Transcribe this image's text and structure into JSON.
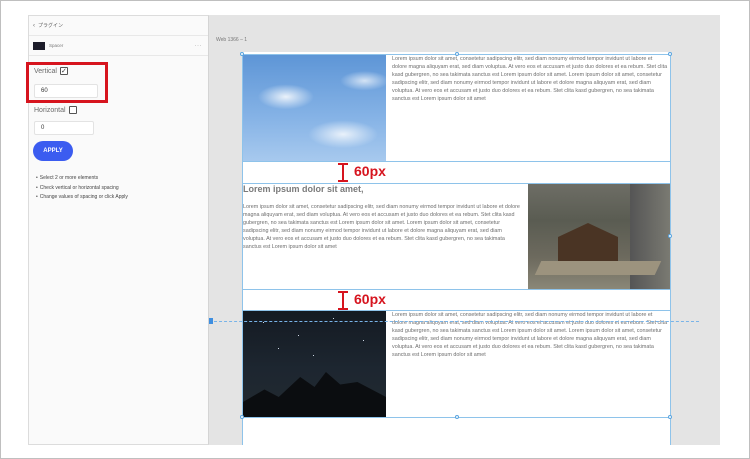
{
  "panel": {
    "back_label": "プラグイン",
    "plugin_name": "Spacer",
    "more": "···",
    "vertical_label": "Vertical",
    "vertical_checked": "✓",
    "vertical_value": "60",
    "horizontal_label": "Horizontal",
    "horizontal_value": "0",
    "apply_label": "APPLY",
    "tips": [
      "Select 2 or more elements",
      "Check vertical or horizontal spacing",
      "Change values of spacing or click Apply"
    ]
  },
  "canvas": {
    "artboard_name": "Web 1366 – 1",
    "spacing_1": "60px",
    "spacing_2": "60px",
    "heading": "Lorem ipsum dolor sit amet,",
    "body_1": "Lorem ipsum dolor sit amet, consetetur sadipscing elitr, sed diam nonumy eirmod tempor invidunt ut labore et dolore magna aliquyam erat, sed diam voluptua. At vero eos et accusam et justo duo dolores et ea rebum. Stet clita kasd gubergren, no sea takimata sanctus est Lorem ipsum dolor sit amet. Lorem ipsum dolor sit amet, consetetur sadipscing elitr, sed diam nonumy eirmod tempor invidunt ut labore et dolore magna aliquyam erat, sed diam voluptua. At vero eos et accusam et justo duo dolores et ea rebum. Stet clita kasd gubergren, no sea takimata sanctus est Lorem ipsum dolor sit amet",
    "body_2": "Lorem ipsum dolor sit amet, consetetur sadipscing elitr, sed diam nonumy eirmod tempor invidunt ut labore et dolore magna aliquyam erat, sed diam voluptua. At vero eos et accusam et justo duo dolores et ea rebum. Stet clita kasd gubergren, no sea takimata sanctus est Lorem ipsum dolor sit amet. Lorem ipsum dolor sit amet, consetetur sadipscing elitr, sed diam nonumy eirmod tempor invidunt ut labore et dolore magna aliquyam erat, sed diam voluptua. At vero eos et accusam et justo duo dolores et ea rebum. Stet clita kasd gubergren, no sea takimata sanctus est Lorem ipsum dolor sit amet",
    "body_3": "Lorem ipsum dolor sit amet, consetetur sadipscing elitr, sed diam nonumy eirmod tempor invidunt ut labore et dolore magna aliquyam erat, sed diam voluptua. At vero eos et accusam et justo duo dolores et ea rebum. Stet clita kasd gubergren, no sea takimata sanctus est Lorem ipsum dolor sit amet. Lorem ipsum dolor sit amet, consetetur sadipscing elitr, sed diam nonumy eirmod tempor invidunt ut labore et dolore magna aliquyam erat, sed diam voluptua. At vero eos et accusam et justo duo dolores et ea rebum. Stet clita kasd gubergren, no sea takimata sanctus est Lorem ipsum dolor sit amet"
  },
  "colors": {
    "accent_red": "#d6141e",
    "apply_blue": "#3b5cf0",
    "selection_blue": "#8ec3ea"
  }
}
